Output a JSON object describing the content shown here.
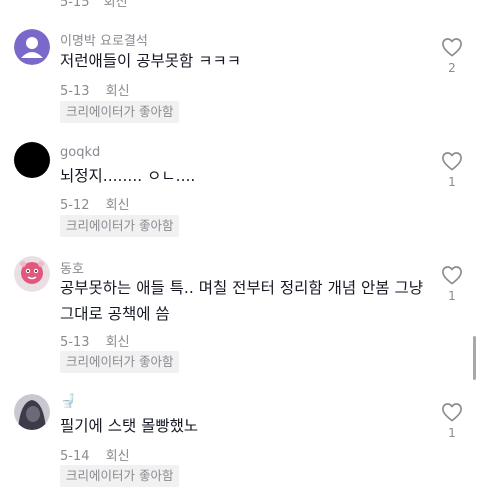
{
  "top_partial": {
    "date": "5-15",
    "reply": "회신"
  },
  "comments": [
    {
      "username": "이명박 요로결석",
      "text": "저런애들이 공부못함 ㅋㅋㅋ",
      "date": "5-13",
      "reply": "회신",
      "badge": "크리에이터가 좋아함",
      "likes": "2",
      "avatar": "default-user-avatar"
    },
    {
      "username": "goqkd",
      "text": "뇌정지........ ㅇㄴ....",
      "date": "5-12",
      "reply": "회신",
      "badge": "크리에이터가 좋아함",
      "likes": "1",
      "avatar": "black-circle-avatar"
    },
    {
      "username": "동호",
      "text": "공부못하는 애들 특.. 며칠 전부터 정리함 개념 안봄 그냥 그대로 공책에 씀",
      "date": "5-13",
      "reply": "회신",
      "badge": "크리에이터가 좋아함",
      "likes": "1",
      "avatar": "pink-character-avatar"
    },
    {
      "username": "🚽",
      "text": "필기에 스탯 몰빵했노",
      "date": "5-14",
      "reply": "회신",
      "badge": "크리에이터가 좋아함",
      "likes": "1",
      "avatar": "hooded-figure-avatar"
    }
  ],
  "colors": {
    "text": "#161823",
    "secondary": "#8a8b91",
    "badge_bg": "#f1f1f2"
  }
}
